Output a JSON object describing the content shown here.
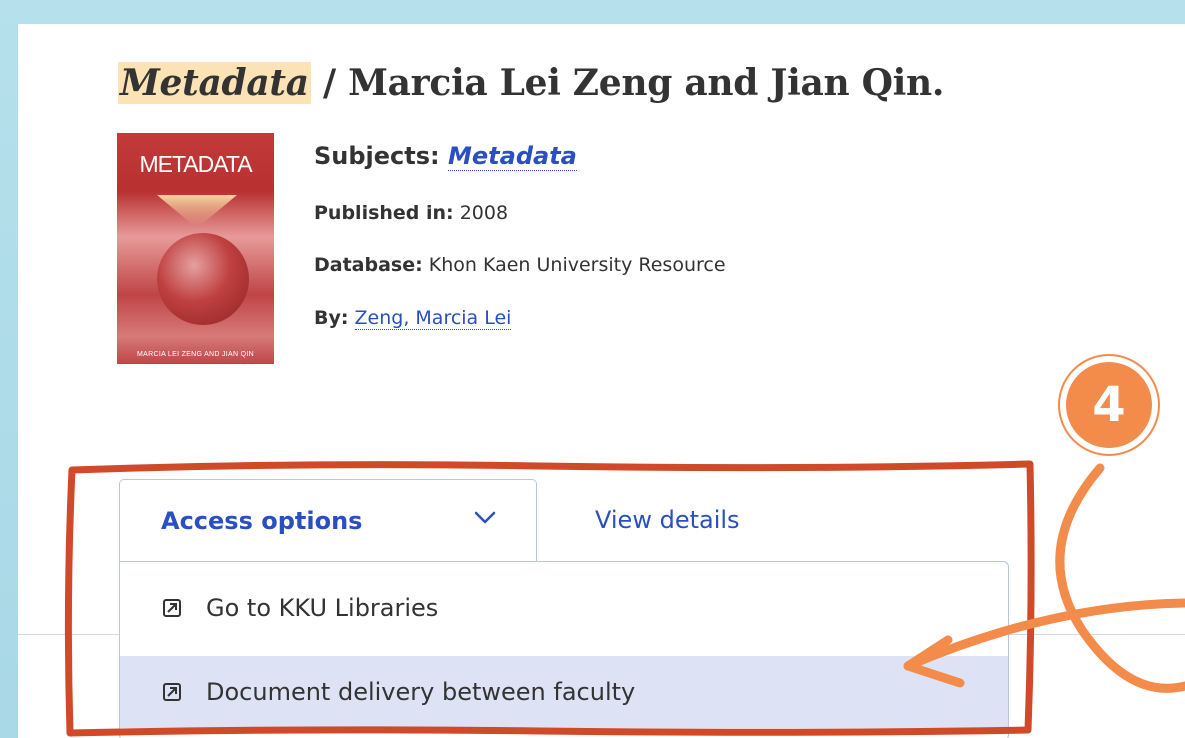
{
  "record": {
    "title_highlight": "Metadata",
    "title_rest": " / Marcia Lei Zeng and Jian Qin.",
    "subjects_label": "Subjects:",
    "subjects_value": "Metadata",
    "published_label": "Published in:",
    "published_value": "2008",
    "database_label": "Database:",
    "database_value": "Khon Kaen University Resource",
    "by_label": "By:",
    "by_value": "Zeng, Marcia Lei"
  },
  "cover": {
    "title": "METADATA",
    "authors": "MARCIA LEI ZENG AND JIAN QIN"
  },
  "tabs": {
    "access_options": "Access options",
    "view_details": "View details"
  },
  "menu": {
    "items": [
      {
        "label": "Go to KKU Libraries",
        "icon": "external-link-icon"
      },
      {
        "label": "Document delivery between faculty",
        "icon": "external-link-icon"
      }
    ]
  },
  "annotation": {
    "step_number": "4",
    "accent_color": "#f38b4a",
    "frame_color": "#d04a2a"
  }
}
